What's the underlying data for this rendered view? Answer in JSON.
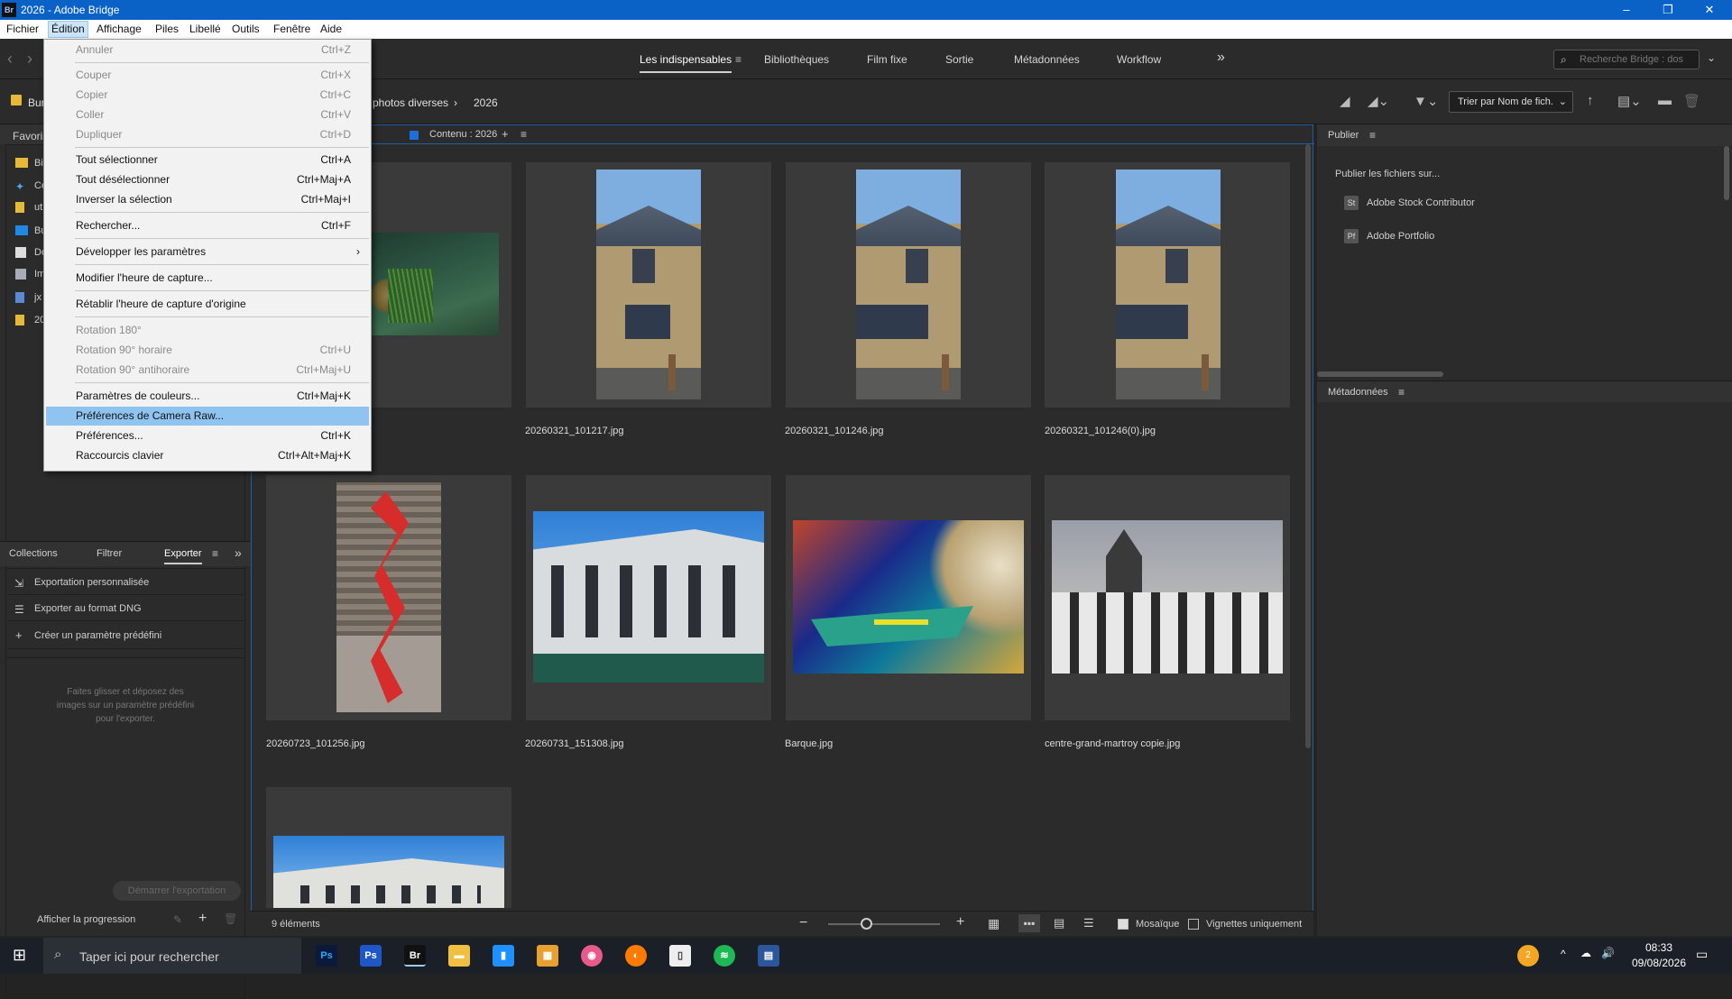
{
  "titlebar": {
    "logo": "Br",
    "title": "2026 - Adobe Bridge",
    "min": "–",
    "max": "❐",
    "close": "✕"
  },
  "menubar": {
    "items": [
      "Fichier",
      "Édition",
      "Affichage",
      "Piles",
      "Libellé",
      "Outils",
      "Fenêtre",
      "Aide"
    ]
  },
  "workspaces": {
    "items": [
      "Les indispensables",
      "Bibliothèques",
      "Film fixe",
      "Sortie",
      "Métadonnées",
      "Workflow"
    ],
    "more": "»",
    "search_placeholder": "Recherche Bridge : dos"
  },
  "path": {
    "crumb1": "Bur",
    "crumb2": "photos diverses",
    "sep": "›",
    "crumb3": "2026",
    "sort_label": "Trier par Nom de fich."
  },
  "left_panel": {
    "favorites_tab": "Favoris",
    "favorites": [
      "Bi",
      "Ce",
      "ut",
      "Bu",
      "Do",
      "Im",
      "jx",
      "20"
    ],
    "tabs": [
      "Collections",
      "Filtrer",
      "Exporter"
    ],
    "export_items": [
      "Exportation personnalisée",
      "Exporter au format DNG",
      "Créer un paramètre prédéfini"
    ],
    "drop_hint": "Faites glisser et déposez des images sur un paramètre prédéfini pour l'exporter.",
    "start_export": "Démarrer l'exportation",
    "show_progress": "Afficher la progression"
  },
  "content": {
    "tab_label": "Contenu : 2026",
    "add": "+",
    "menu": "≡",
    "thumbs": [
      {
        "name": ""
      },
      {
        "name": "20260321_101217.jpg"
      },
      {
        "name": "20260321_101246.jpg"
      },
      {
        "name": "20260321_101246(0).jpg"
      },
      {
        "name": "20260723_101256.jpg"
      },
      {
        "name": "20260731_151308.jpg"
      },
      {
        "name": "Barque.jpg"
      },
      {
        "name": "centre-grand-martroy copie.jpg"
      },
      {
        "name": ""
      }
    ],
    "count": "9 éléments",
    "mosaic_label": "Mosaïque",
    "thumbs_only_label": "Vignettes uniquement",
    "zoom_fraction": 0.35
  },
  "right_panel": {
    "publish_title": "Publier",
    "publish_to": "Publier les fichiers sur...",
    "services": [
      {
        "icon": "St",
        "label": "Adobe Stock Contributor"
      },
      {
        "icon": "Pf",
        "label": "Adobe Portfolio"
      }
    ],
    "metadata_title": "Métadonnées"
  },
  "edit_menu": {
    "items": [
      {
        "label": "Annuler",
        "shortcut": "Ctrl+Z"
      },
      {
        "label": "Couper",
        "shortcut": "Ctrl+X"
      },
      {
        "label": "Copier",
        "shortcut": "Ctrl+C"
      },
      {
        "label": "Coller",
        "shortcut": "Ctrl+V"
      },
      {
        "label": "Dupliquer",
        "shortcut": "Ctrl+D"
      },
      {
        "label": "Tout sélectionner",
        "shortcut": "Ctrl+A"
      },
      {
        "label": "Tout désélectionner",
        "shortcut": "Ctrl+Maj+A"
      },
      {
        "label": "Inverser la sélection",
        "shortcut": "Ctrl+Maj+I"
      },
      {
        "label": "Rechercher...",
        "shortcut": "Ctrl+F"
      },
      {
        "label": "Développer les paramètres",
        "shortcut": "›"
      },
      {
        "label": "Modifier l'heure de capture...",
        "shortcut": ""
      },
      {
        "label": "Rétablir l'heure de capture d'origine",
        "shortcut": ""
      },
      {
        "label": "Rotation 180°",
        "shortcut": ""
      },
      {
        "label": "Rotation 90° horaire",
        "shortcut": "Ctrl+U"
      },
      {
        "label": "Rotation 90° antihoraire",
        "shortcut": "Ctrl+Maj+U"
      },
      {
        "label": "Paramètres de couleurs...",
        "shortcut": "Ctrl+Maj+K"
      },
      {
        "label": "Préférences de Camera Raw...",
        "shortcut": ""
      },
      {
        "label": "Préférences...",
        "shortcut": "Ctrl+K"
      },
      {
        "label": "Raccourcis clavier",
        "shortcut": "Ctrl+Alt+Maj+K"
      }
    ]
  },
  "taskbar": {
    "search_placeholder": "Taper ici pour rechercher",
    "time": "08:33",
    "date": "09/08/2026",
    "notif_badge": "2"
  }
}
